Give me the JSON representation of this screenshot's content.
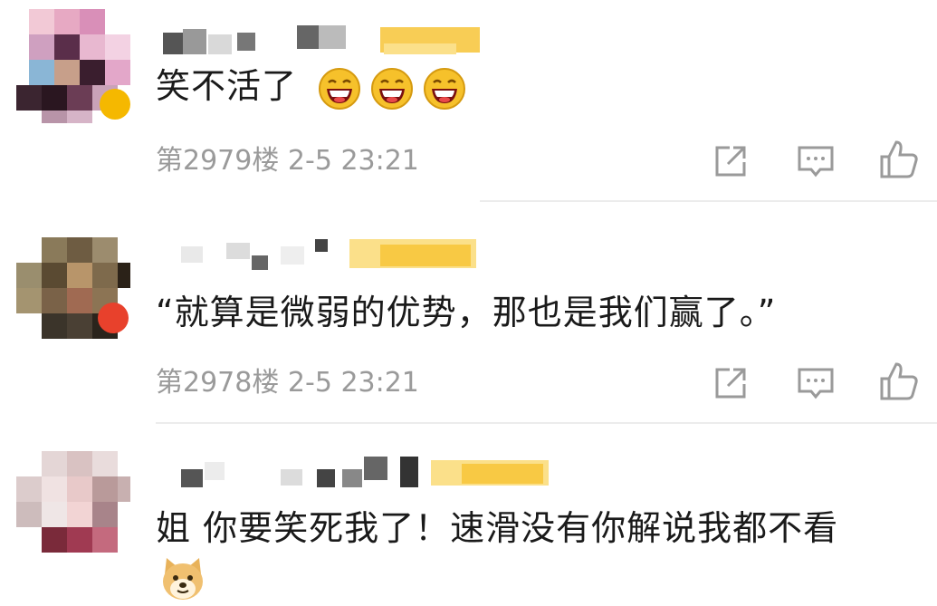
{
  "comments": [
    {
      "text": "笑不活了",
      "emoji": [
        "laughing-face-icon",
        "laughing-face-icon",
        "laughing-face-icon"
      ],
      "floor": "第2979楼",
      "time": "2-5 23:21"
    },
    {
      "text": "“就算是微弱的优势，那也是我们赢了。”",
      "floor": "第2978楼",
      "time": "2-5 23:21"
    },
    {
      "text": "姐 你要笑死我了！速滑没有你解说我都不看",
      "emoji": [
        "doge-icon"
      ]
    }
  ],
  "actions": [
    "share-icon",
    "reply-icon",
    "like-icon"
  ],
  "colors": {
    "meta_text": "#9a9a9a",
    "divider": "#ececec",
    "name_highlight": "#f7c437"
  }
}
